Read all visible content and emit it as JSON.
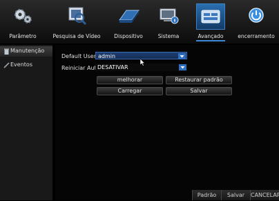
{
  "top_tabs": [
    {
      "label": "Parâmetro",
      "icon": "gear-icon"
    },
    {
      "label": "Pesquisa de Vídeo",
      "icon": "video-search-icon"
    },
    {
      "label": "Dispositivo",
      "icon": "hard-drive-icon"
    },
    {
      "label": "Sistema",
      "icon": "monitor-info-icon"
    },
    {
      "label": "Avançado",
      "icon": "advanced-settings-icon"
    },
    {
      "label": "encerramento",
      "icon": "power-icon"
    }
  ],
  "active_tab": "Avançado",
  "sidebar": {
    "items": [
      {
        "label": "Manutenção",
        "icon": "trash-icon"
      },
      {
        "label": "Eventos",
        "icon": "pencil-icon"
      }
    ]
  },
  "form": {
    "default_user_label": "Default User",
    "default_user_value": "admin",
    "auto_reboot_label": "Reiniciar Auto",
    "auto_reboot_value": "DESATIVAR"
  },
  "buttons": {
    "upgrade": "melhorar",
    "restore_default": "Restaurar padrão",
    "load": "Carregar",
    "save": "Salvar"
  },
  "bottom_bar": {
    "default": "Padrão",
    "save": "Salvar",
    "cancel": "CANCELAR"
  },
  "colors": {
    "accent": "#3c8ad6",
    "selected_field": "#1e3f73",
    "background": "#000000"
  }
}
